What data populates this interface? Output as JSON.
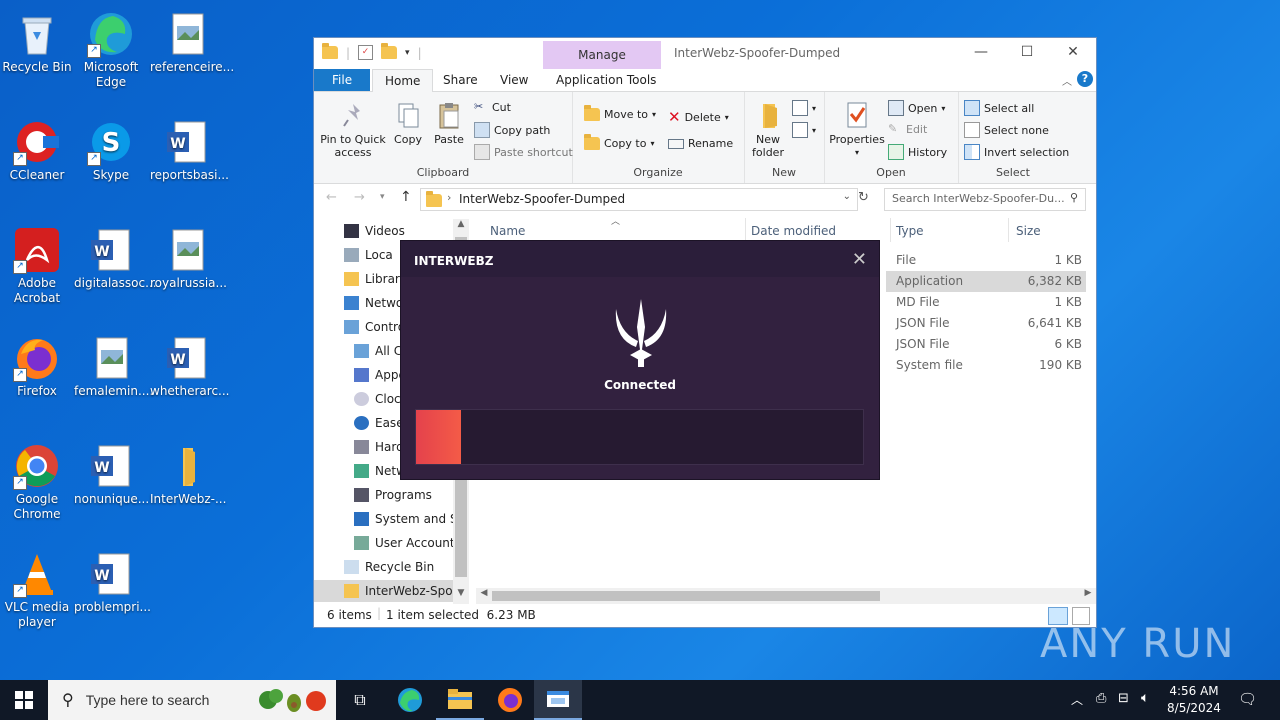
{
  "desktop": {
    "icons": [
      {
        "label": "Recycle Bin"
      },
      {
        "label": "Microsoft Edge"
      },
      {
        "label": "referenceire..."
      },
      {
        "label": "CCleaner"
      },
      {
        "label": "Skype"
      },
      {
        "label": "reportsbasi..."
      },
      {
        "label": "Adobe Acrobat"
      },
      {
        "label": "digitalassoc..."
      },
      {
        "label": "royalrussia..."
      },
      {
        "label": "Firefox"
      },
      {
        "label": "femalemin...."
      },
      {
        "label": "whetherarc..."
      },
      {
        "label": "Google Chrome"
      },
      {
        "label": "nonunique..."
      },
      {
        "label": "InterWebz-..."
      },
      {
        "label": "VLC media player"
      },
      {
        "label": "problempri..."
      }
    ],
    "watermark": "ANY RUN"
  },
  "explorer": {
    "title": "InterWebz-Spoofer-Dumped",
    "manage_tab": "Manage",
    "tabs": {
      "file": "File",
      "home": "Home",
      "share": "Share",
      "view": "View",
      "app_tools": "Application Tools"
    },
    "ribbon": {
      "clipboard": {
        "label": "Clipboard",
        "pin": "Pin to Quick access",
        "copy": "Copy",
        "paste": "Paste",
        "cut": "Cut",
        "copy_path": "Copy path",
        "paste_shortcut": "Paste shortcut"
      },
      "organize": {
        "label": "Organize",
        "move_to": "Move to",
        "copy_to": "Copy to",
        "delete": "Delete",
        "rename": "Rename"
      },
      "new": {
        "label": "New",
        "new_folder": "New folder"
      },
      "open": {
        "label": "Open",
        "properties": "Properties",
        "open": "Open",
        "edit": "Edit",
        "history": "History"
      },
      "select": {
        "label": "Select",
        "select_all": "Select all",
        "select_none": "Select none",
        "invert": "Invert selection"
      }
    },
    "address": "InterWebz-Spoofer-Dumped",
    "search_placeholder": "Search InterWebz-Spoofer-Du...",
    "nav_items": [
      "Videos",
      "Loca",
      "Librari",
      "Netwo",
      "Contro",
      "All C",
      "Appe",
      "Clocl",
      "Ease",
      "Hard",
      "Netw",
      "Programs",
      "System and Se",
      "User Accounts",
      "Recycle Bin",
      "InterWebz-Spoo"
    ],
    "columns": {
      "name": "Name",
      "date": "Date modified",
      "type": "Type",
      "size": "Size"
    },
    "rows": [
      {
        "type": "File",
        "size": "1 KB"
      },
      {
        "type": "Application",
        "size": "6,382 KB"
      },
      {
        "type": "MD File",
        "size": "1 KB"
      },
      {
        "type": "JSON File",
        "size": "6,641 KB"
      },
      {
        "type": "JSON File",
        "size": "6 KB"
      },
      {
        "type": "System file",
        "size": "190 KB"
      }
    ],
    "status": {
      "items": "6 items",
      "selected": "1 item selected  6.23 MB"
    }
  },
  "popup": {
    "title": "INTERWEBZ",
    "status": "Connected",
    "progress": 0.1,
    "accent": "#e4424c"
  },
  "taskbar": {
    "search_placeholder": "Type here to search",
    "time": "4:56 AM",
    "date": "8/5/2024"
  }
}
